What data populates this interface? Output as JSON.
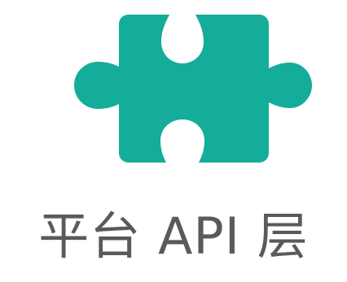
{
  "icon": {
    "name": "puzzle-piece-icon",
    "color": "#14ad99"
  },
  "caption": {
    "text": "平台 API 层",
    "color": "#5a5a5a"
  }
}
